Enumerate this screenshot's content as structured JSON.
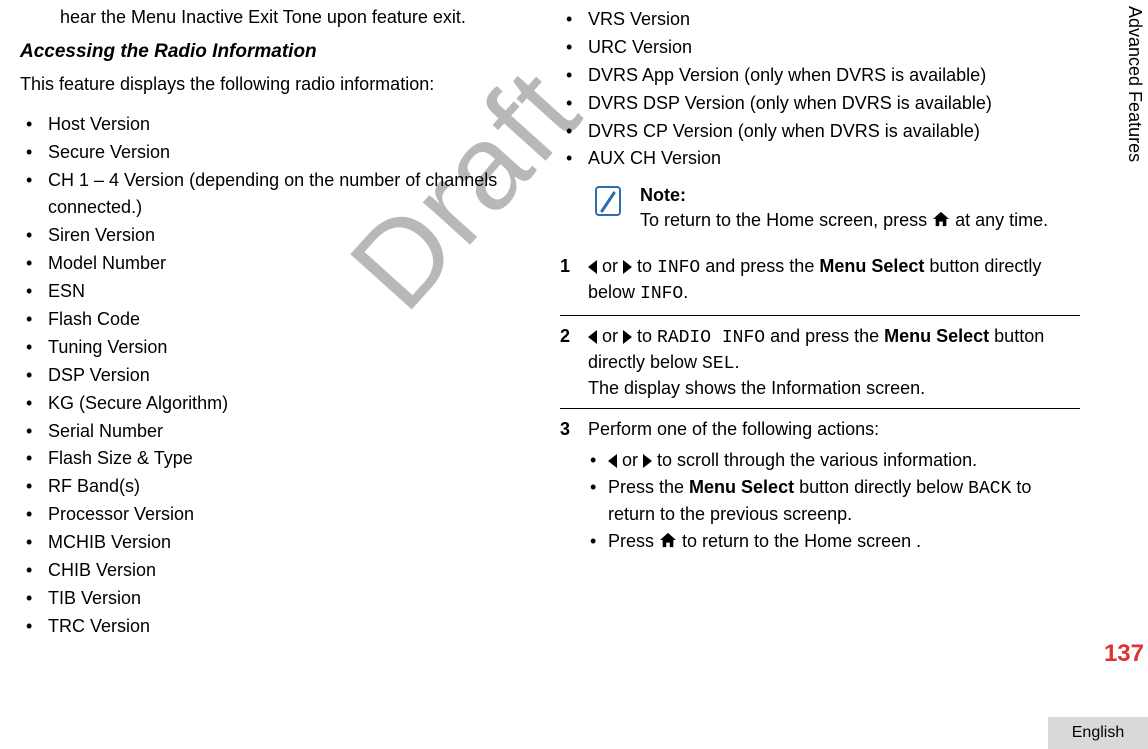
{
  "watermark": "Draft",
  "side_tab": "Advanced Features",
  "page_number": "137",
  "language": "English",
  "left": {
    "hear_text": "hear the Menu Inactive Exit Tone upon feature exit.",
    "subheading": "Accessing the Radio Information",
    "intro": "This feature displays the following radio information:",
    "items": [
      "Host Version",
      "Secure Version",
      "CH 1 – 4 Version (depending on the number of channels connected.)",
      "Siren Version",
      "Model Number",
      "ESN",
      "Flash Code",
      "Tuning Version",
      "DSP Version",
      "KG (Secure Algorithm)",
      "Serial Number",
      "Flash Size & Type",
      "RF Band(s)",
      "Processor Version",
      "MCHIB Version",
      "CHIB Version",
      "TIB Version",
      "TRC Version"
    ]
  },
  "right": {
    "items": [
      "VRS Version",
      "URC Version",
      "DVRS App Version (only when DVRS is available)",
      "DVRS DSP Version (only when DVRS is available)",
      "DVRS CP Version (only when DVRS is available)",
      "AUX CH Version"
    ],
    "note": {
      "label": "Note:",
      "before_icon": "To return to the Home screen, press ",
      "after_icon": " at any time."
    },
    "steps": {
      "s1": {
        "num": "1",
        "or": " or ",
        "to": " to ",
        "code1": "INFO",
        "mid": " and press the ",
        "menu_select": "Menu Select",
        "tail": " button directly below ",
        "code2": "INFO",
        "period": "."
      },
      "s2": {
        "num": "2",
        "or": " or ",
        "to": " to ",
        "code1": "RADIO INFO",
        "mid": " and press the ",
        "menu_select": "Menu Select",
        "tail": " button directly below ",
        "code2": "SEL",
        "period": ".",
        "line2": "The display shows the Information screen."
      },
      "s3": {
        "num": "3",
        "lead": "Perform one of the following actions:",
        "b1": {
          "or": " or ",
          "tail": " to scroll through the various information."
        },
        "b2": {
          "pre": "Press the ",
          "menu_select": "Menu Select",
          "mid": " button directly below ",
          "code": "BACK",
          "tail": " to return to the previous screenp."
        },
        "b3": {
          "pre": "Press ",
          "tail": " to return to the Home screen ."
        }
      }
    }
  }
}
